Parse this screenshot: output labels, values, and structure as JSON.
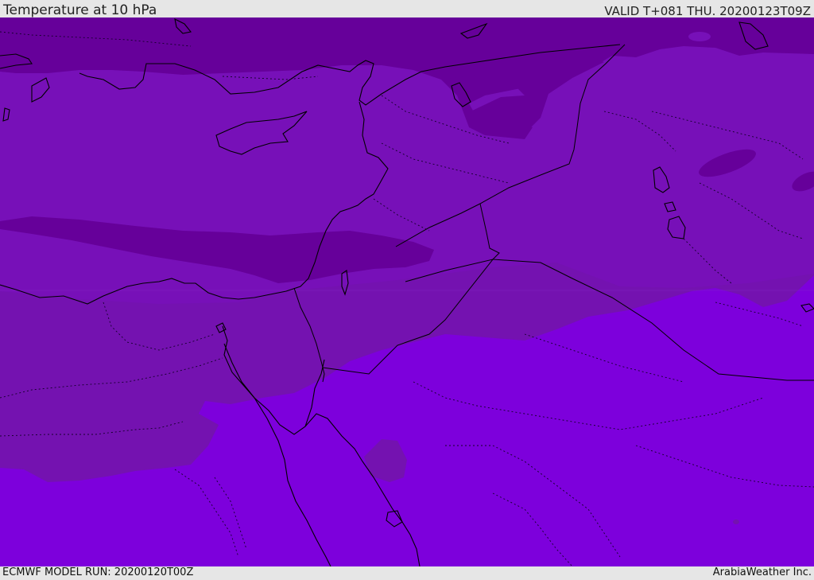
{
  "header": {
    "title": "Temperature at 10 hPa",
    "valid_time": "VALID T+081 THU. 20200123T09Z"
  },
  "footer": {
    "model_run": "ECMWF MODEL RUN: 20200120T00Z",
    "credit": "ArabiaWeather Inc."
  },
  "map": {
    "colors": {
      "band_dark": "#66009a",
      "band_mid": "#7710b8",
      "band_mid2": "#7412b0",
      "band_bright": "#7d00dc",
      "coastline": "#000000",
      "border": "#1a0030"
    }
  }
}
